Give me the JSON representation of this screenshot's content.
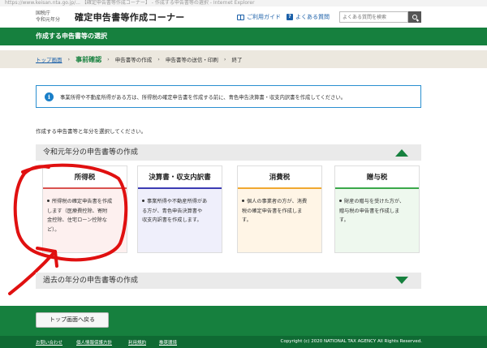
{
  "window_title": "https://www.keisan.nta.go.jp/... 【確定申告書等作成コーナー】 - 作成する申告書等の選択 - Internet Explorer",
  "header": {
    "agency_line1": "国税庁",
    "agency_line2": "令和元年分",
    "site_title": "確定申告書等作成コーナー",
    "guide_link": "ご利用ガイド",
    "faq_link": "よくある質問",
    "search_placeholder": "よくある質問を検索"
  },
  "page_heading": "作成する申告書等の選択",
  "steps": {
    "home": "トップ画面",
    "step1": "事前確認",
    "step2": "申告書等の作成",
    "step3": "申告書等の送信・印刷",
    "step4": "終了",
    "separator": "›"
  },
  "notice": {
    "icon": "i",
    "text": "事業所得や不動産所得がある方は、所得税の確定申告書を作成する前に、青色申告決算書・収支内訳書を作成してください。"
  },
  "instruction": "作成する申告書等と年分を選択してください。",
  "current_year_section": "令和元年分の申告書等の作成",
  "cards": {
    "income": {
      "title": "所得税",
      "line1": "所得税の確定申告書を作成",
      "line2": "します（医療費控除、寄附",
      "line3": "金控除、住宅ローン控除な",
      "line4": "ど）。"
    },
    "settle": {
      "title": "決算書・収支内訳書",
      "line1": "事業所得や不動産所得があ",
      "line2": "る方が、青色申告決算書や",
      "line3": "収支内訳書を作成します。"
    },
    "consumption": {
      "title": "消費税",
      "line1": "個人の事業者の方が、消費",
      "line2": "税の確定申告書を作成しま",
      "line3": "す。"
    },
    "gift": {
      "title": "贈与税",
      "line1": "財産の贈与を受けた方が、",
      "line2": "贈与税の申告書を作成しま",
      "line3": "す。"
    }
  },
  "past_year_section": "過去の年分の申告書等の作成",
  "footer": {
    "back_button": "トップ画面へ戻る",
    "link_contact": "お問い合わせ",
    "link_privacy": "個人情報保護方針",
    "link_terms": "利用規約",
    "link_env": "推奨環境",
    "copyright": "Copyright (c) 2020 NATIONAL TAX AGENCY All Rights Reserved."
  },
  "colors": {
    "brand_green": "#16803e",
    "annotation_red": "#e01010"
  }
}
